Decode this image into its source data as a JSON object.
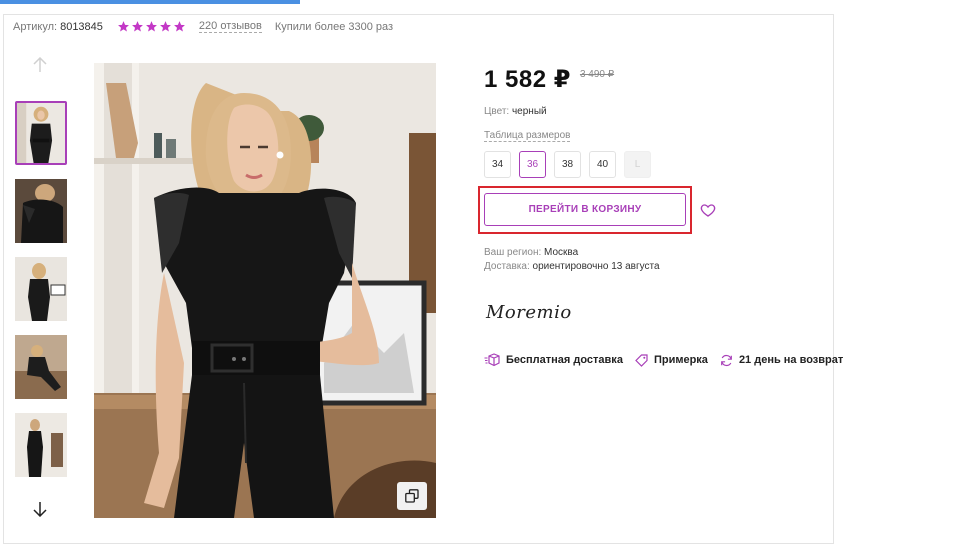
{
  "product": {
    "sku_label": "Артикул:",
    "sku_value": "8013845",
    "rating": 5,
    "reviews": "220 отзывов",
    "bought": "Купили более 3300 раз",
    "price": "1 582 ₽",
    "old_price": "3 490 ₽",
    "color_label": "Цвет:",
    "color_value": "черный",
    "size_table_link": "Таблица размеров",
    "sizes": [
      "34",
      "36",
      "38",
      "40",
      "L"
    ],
    "selected_size": "36",
    "cart_button": "ПЕРЕЙТИ В КОРЗИНУ",
    "region_label": "Ваш регион:",
    "region_value": "Москва",
    "delivery_label": "Доставка:",
    "delivery_value": "ориентировочно 13 августа",
    "brand": "Moremio",
    "benefits": [
      "Бесплатная доставка",
      "Примерка",
      "21 день на возврат"
    ]
  },
  "colors": {
    "accent": "#a83fb8",
    "highlight": "#d9262e",
    "star": "#c338c6"
  },
  "icons": {
    "scroll_up": "arrow-up-icon",
    "scroll_down": "arrow-down-icon",
    "favorite": "heart-icon",
    "zoom": "copy-zoom-icon",
    "delivery": "box-icon",
    "fitting": "tag-icon",
    "return": "refresh-icon"
  }
}
